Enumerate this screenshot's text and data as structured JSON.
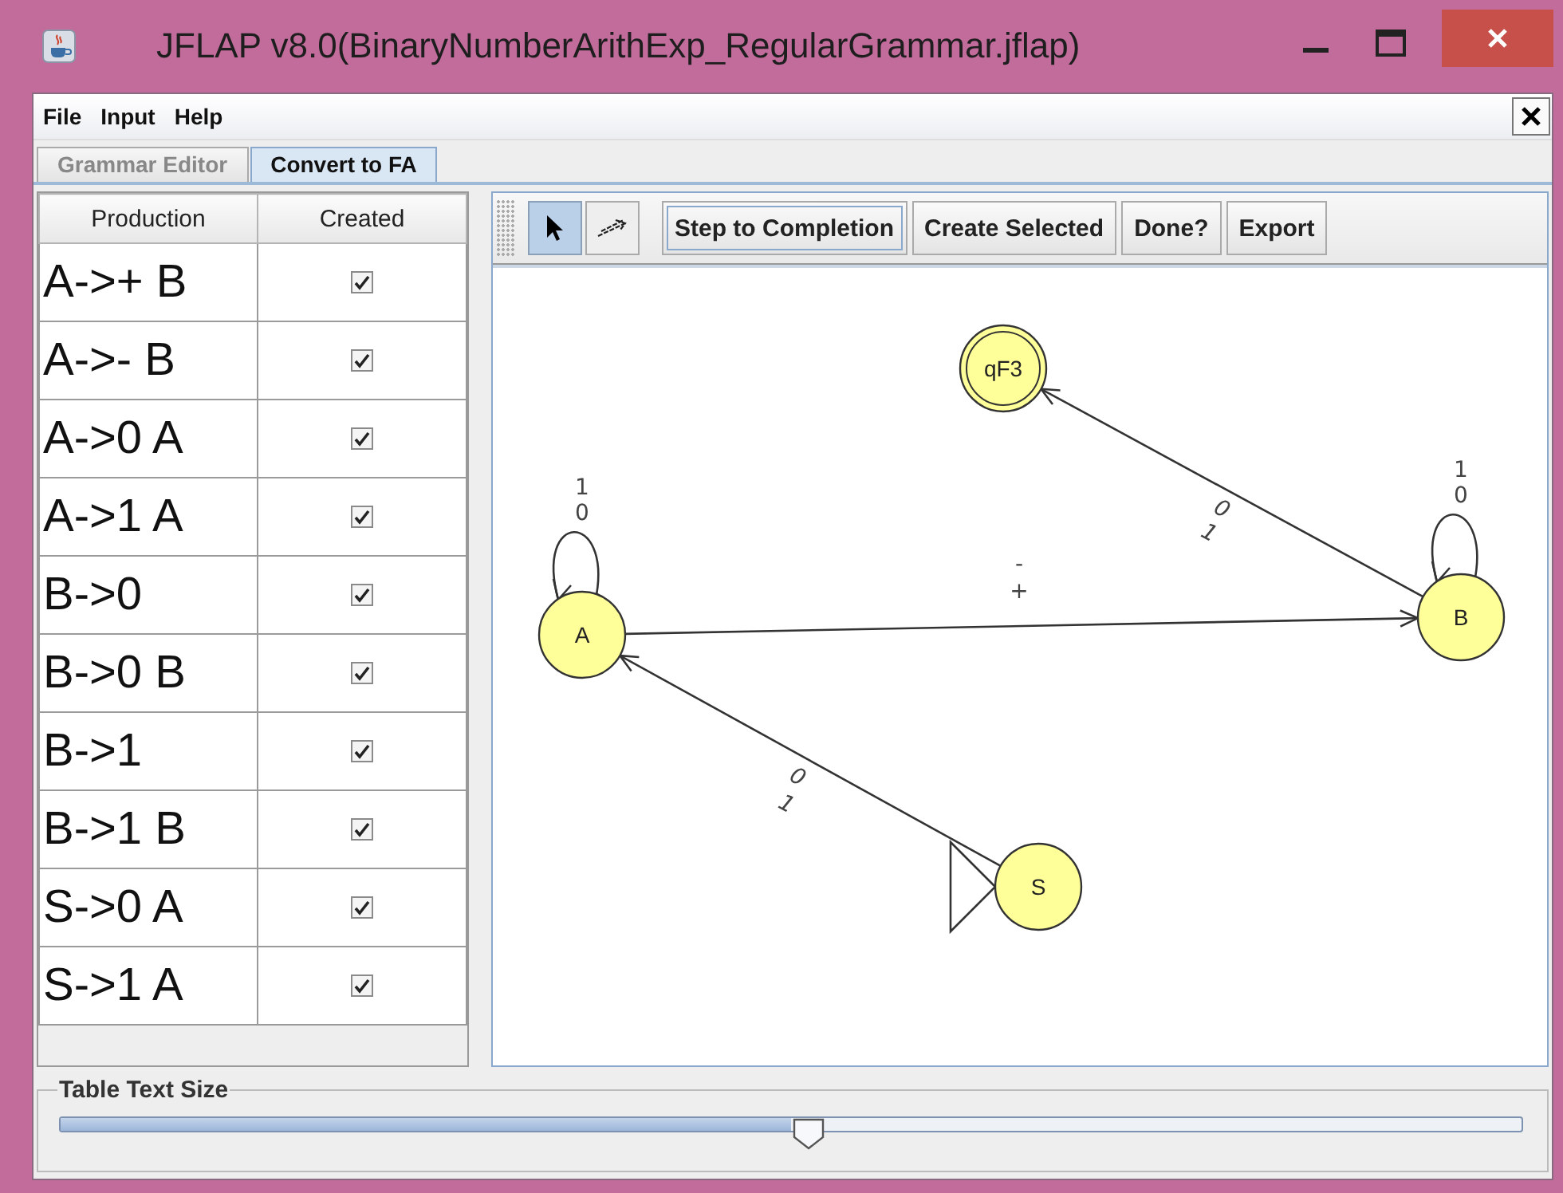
{
  "window": {
    "title": "JFLAP v8.0(BinaryNumberArithExp_RegularGrammar.jflap)"
  },
  "menu": [
    "File",
    "Input",
    "Help"
  ],
  "tabs": [
    {
      "label": "Grammar Editor",
      "selected": false
    },
    {
      "label": "Convert to FA",
      "selected": true
    }
  ],
  "table": {
    "columns": [
      "Production",
      "Created"
    ],
    "rows": [
      {
        "production": "A->+ B",
        "created": true
      },
      {
        "production": "A->- B",
        "created": true
      },
      {
        "production": "A->0 A",
        "created": true
      },
      {
        "production": "A->1 A",
        "created": true
      },
      {
        "production": "B->0",
        "created": true
      },
      {
        "production": "B->0 B",
        "created": true
      },
      {
        "production": "B->1",
        "created": true
      },
      {
        "production": "B->1 B",
        "created": true
      },
      {
        "production": "S->0 A",
        "created": true
      },
      {
        "production": "S->1 A",
        "created": true
      }
    ]
  },
  "tools": [
    {
      "kind": "pointer",
      "selected": true
    },
    {
      "kind": "transition",
      "selected": false
    }
  ],
  "buttons": [
    "Step to Completion",
    "Create Selected",
    "Done?",
    "Export"
  ],
  "states": [
    {
      "name": "A",
      "final": false,
      "initial": false
    },
    {
      "name": "B",
      "final": false,
      "initial": false
    },
    {
      "name": "qF3",
      "final": true,
      "initial": false
    },
    {
      "name": "S",
      "final": false,
      "initial": true
    }
  ],
  "transitions": [
    {
      "labels": [
        "1",
        "0"
      ]
    },
    {
      "labels": [
        "-",
        "+"
      ]
    },
    {
      "labels": [
        "1",
        "0"
      ]
    },
    {
      "labels": [
        "0",
        "1"
      ]
    },
    {
      "labels": [
        "0",
        "1"
      ]
    }
  ],
  "slider": {
    "label": "Table Text Size",
    "level": 0.5
  }
}
